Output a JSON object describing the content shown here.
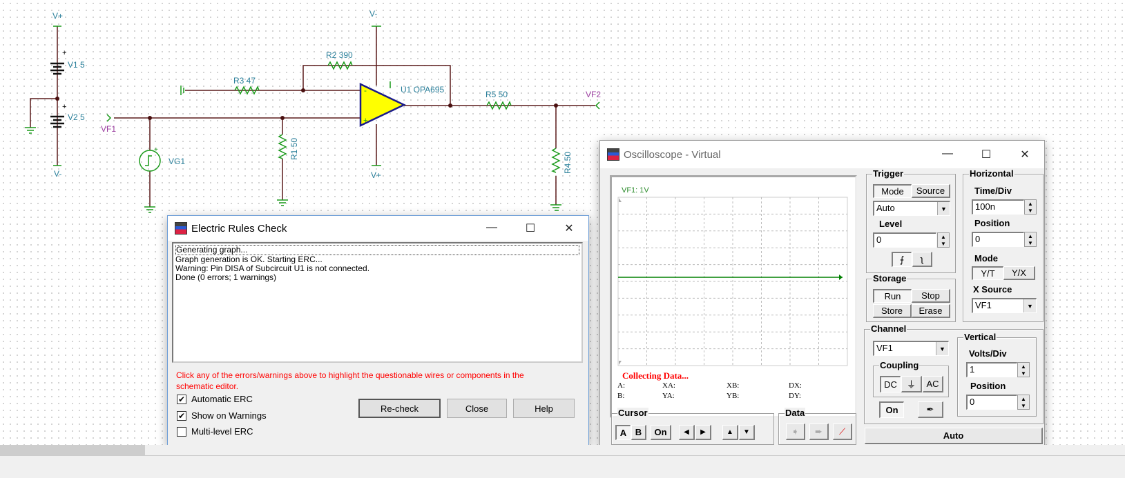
{
  "schematic": {
    "v_plus": "V+",
    "v_minus": "V-",
    "v1": "V1 5",
    "v2": "V2 5",
    "vf1": "VF1",
    "vf2": "VF2",
    "vg1": "VG1",
    "r1": "R1 50",
    "r2": "R2 390",
    "r3": "R3 47",
    "r4": "R4 50",
    "r5": "R5 50",
    "u1": "U1 OPA695",
    "plus": "+",
    "minus": "-"
  },
  "erc": {
    "title": "Electric Rules Check",
    "log": [
      "Generating graph...",
      "Graph generation is OK. Starting ERC...",
      "Warning: Pin DISA of Subcircuit U1 is not connected.",
      "Done (0 errors; 1 warnings)"
    ],
    "hint": "Click any of the errors/warnings above to highlight the questionable wires or components in the schematic editor.",
    "checks": [
      {
        "label": "Automatic ERC",
        "checked": true
      },
      {
        "label": "Show on Warnings",
        "checked": true
      },
      {
        "label": "Multi-level ERC",
        "checked": false
      }
    ],
    "buttons": {
      "recheck": "Re-check",
      "close": "Close",
      "help": "Help"
    },
    "hint_color": "#ff0000"
  },
  "scope": {
    "title": "Oscilloscope - Virtual",
    "channel_label": "VF1: 1V",
    "status": "Collecting Data...",
    "cursor_labels": {
      "a": "A:",
      "b": "B:",
      "xa": "XA:",
      "ya": "YA:",
      "xb": "XB:",
      "yb": "YB:",
      "dx": "DX:",
      "dy": "DY:"
    },
    "trigger": {
      "title": "Trigger",
      "mode": "Mode",
      "source": "Source",
      "mode_value": "Auto",
      "level_label": "Level",
      "level": "0"
    },
    "horizontal": {
      "title": "Horizontal",
      "time_div_label": "Time/Div",
      "time_div": "100n",
      "position_label": "Position",
      "position": "0",
      "mode_label": "Mode",
      "yt": "Y/T",
      "yx": "Y/X",
      "xsource_label": "X Source",
      "xsource": "VF1"
    },
    "storage": {
      "title": "Storage",
      "run": "Run",
      "stop": "Stop",
      "store": "Store",
      "erase": "Erase"
    },
    "channel": {
      "title": "Channel",
      "value": "VF1",
      "coupling": "Coupling",
      "dc": "DC",
      "gnd": "⏚",
      "ac": "AC",
      "on": "On"
    },
    "vertical": {
      "title": "Vertical",
      "volts_div_label": "Volts/Div",
      "volts_div": "1",
      "position_label": "Position",
      "position": "0"
    },
    "cursor": {
      "title": "Cursor",
      "a": "A",
      "b": "B",
      "on": "On",
      "left": "◀",
      "right": "▶",
      "up": "▲",
      "down": "▼"
    },
    "data": {
      "title": "Data"
    },
    "auto": "Auto",
    "trace_color": "#008000"
  }
}
